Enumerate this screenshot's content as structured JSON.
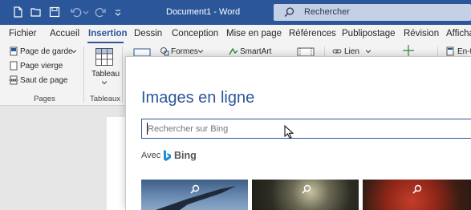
{
  "window": {
    "title": "Document1 - Word",
    "search_placeholder": "Rechercher"
  },
  "ribbon_tabs": [
    "Fichier",
    "Accueil",
    "Insertion",
    "Dessin",
    "Conception",
    "Mise en page",
    "Références",
    "Publipostage",
    "Révision",
    "Affichage"
  ],
  "active_tab": "Insertion",
  "ribbon": {
    "pages_group": {
      "label": "Pages",
      "items": [
        "Page de garde",
        "Page vierge",
        "Saut de page"
      ]
    },
    "tables_group": {
      "label": "Tableaux",
      "button": "Tableau"
    },
    "illustrations": {
      "formes": "Formes",
      "smartart": "SmartArt"
    },
    "links": {
      "lien": "Lien"
    },
    "header_footer": {
      "en_tete": "En-t"
    }
  },
  "dialog": {
    "title": "Images en ligne",
    "search_placeholder": "Rechercher sur Bing",
    "search_value": "",
    "with_label": "Avec",
    "provider": "Bing"
  },
  "colors": {
    "brand": "#2b579a",
    "ribbon_bg": "#f3f3f3",
    "page_bg": "#e6e6e6"
  },
  "icons": [
    "file-icon",
    "folder-open-icon",
    "save-icon",
    "undo-icon",
    "redo-icon",
    "customize-qat-icon",
    "search-icon",
    "cover-page-icon",
    "blank-page-icon",
    "page-break-icon",
    "table-icon",
    "shapes-icon",
    "smartart-icon",
    "link-icon",
    "bing-logo-icon",
    "mouse-cursor-icon"
  ]
}
